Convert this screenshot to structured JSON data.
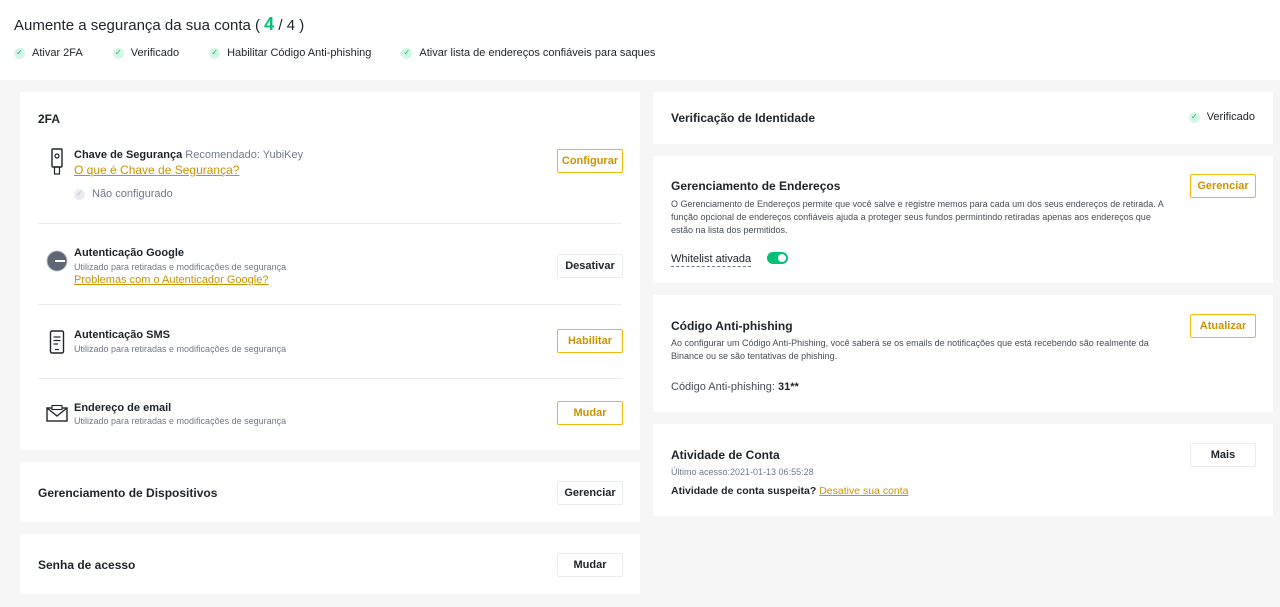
{
  "header": {
    "title_prefix": "Aumente a segurança da sua conta (",
    "count": "4",
    "title_suffix": " / 4 )",
    "items": [
      {
        "label": "Ativar 2FA"
      },
      {
        "label": "Verificado"
      },
      {
        "label": "Habilitar Código Anti-phishing"
      },
      {
        "label": "Ativar lista de endereços confiáveis para saques"
      }
    ]
  },
  "twofa": {
    "title": "2FA",
    "security_key": {
      "title": "Chave de Segurança",
      "recommend": "Recomendado: YubiKey",
      "link": "O que é Chave de Segurança?",
      "status": "Não configurado",
      "button": "Configurar"
    },
    "google": {
      "title": "Autenticação Google",
      "sub": "Utilizado para retiradas e modificações de segurança",
      "link": "Problemas com o Autenticador Google?",
      "button": "Desativar"
    },
    "sms": {
      "title": "Autenticação SMS",
      "sub": "Utilizado para retiradas e modificações de segurança",
      "button": "Habilitar"
    },
    "email": {
      "title": "Endereço de email",
      "sub": "Utilizado para retiradas e modificações de segurança",
      "button": "Mudar"
    }
  },
  "devices": {
    "title": "Gerenciamento de Dispositivos",
    "button": "Gerenciar"
  },
  "password": {
    "title": "Senha de acesso",
    "button": "Mudar"
  },
  "identity": {
    "title": "Verificação de Identidade",
    "status": "Verificado"
  },
  "address": {
    "title": "Gerenciamento de Endereços",
    "desc": "O Gerenciamento de Endereços permite que você salve e registre memos para cada um dos seus endereços de retirada. A função opcional de endereços confiáveis ajuda a proteger seus fundos permintindo retiradas apenas aos endereços que estão na lista dos permitidos.",
    "whitelist_label": "Whitelist ativada",
    "button": "Gerenciar"
  },
  "antiphishing": {
    "title": "Código Anti-phishing",
    "desc": "Ao configurar um Código Anti-Phishing, você saberá se os emails de notificações que está recebendo são realmente da Binance ou se são tentativas de phishing.",
    "code_label": "Código Anti-phishing: ",
    "code_value": "31**",
    "button": "Atualizar"
  },
  "activity": {
    "title": "Atividade de Conta",
    "last_access": "Último acesso:2021-01-13 06:55:28",
    "suspect_label": "Atividade de conta suspeita? ",
    "suspect_link": "Desative sua conta",
    "button": "Mais"
  },
  "colors": {
    "accent": "#f0b90b",
    "success": "#02c076",
    "text": "#1e2329",
    "muted": "#707a8a"
  }
}
